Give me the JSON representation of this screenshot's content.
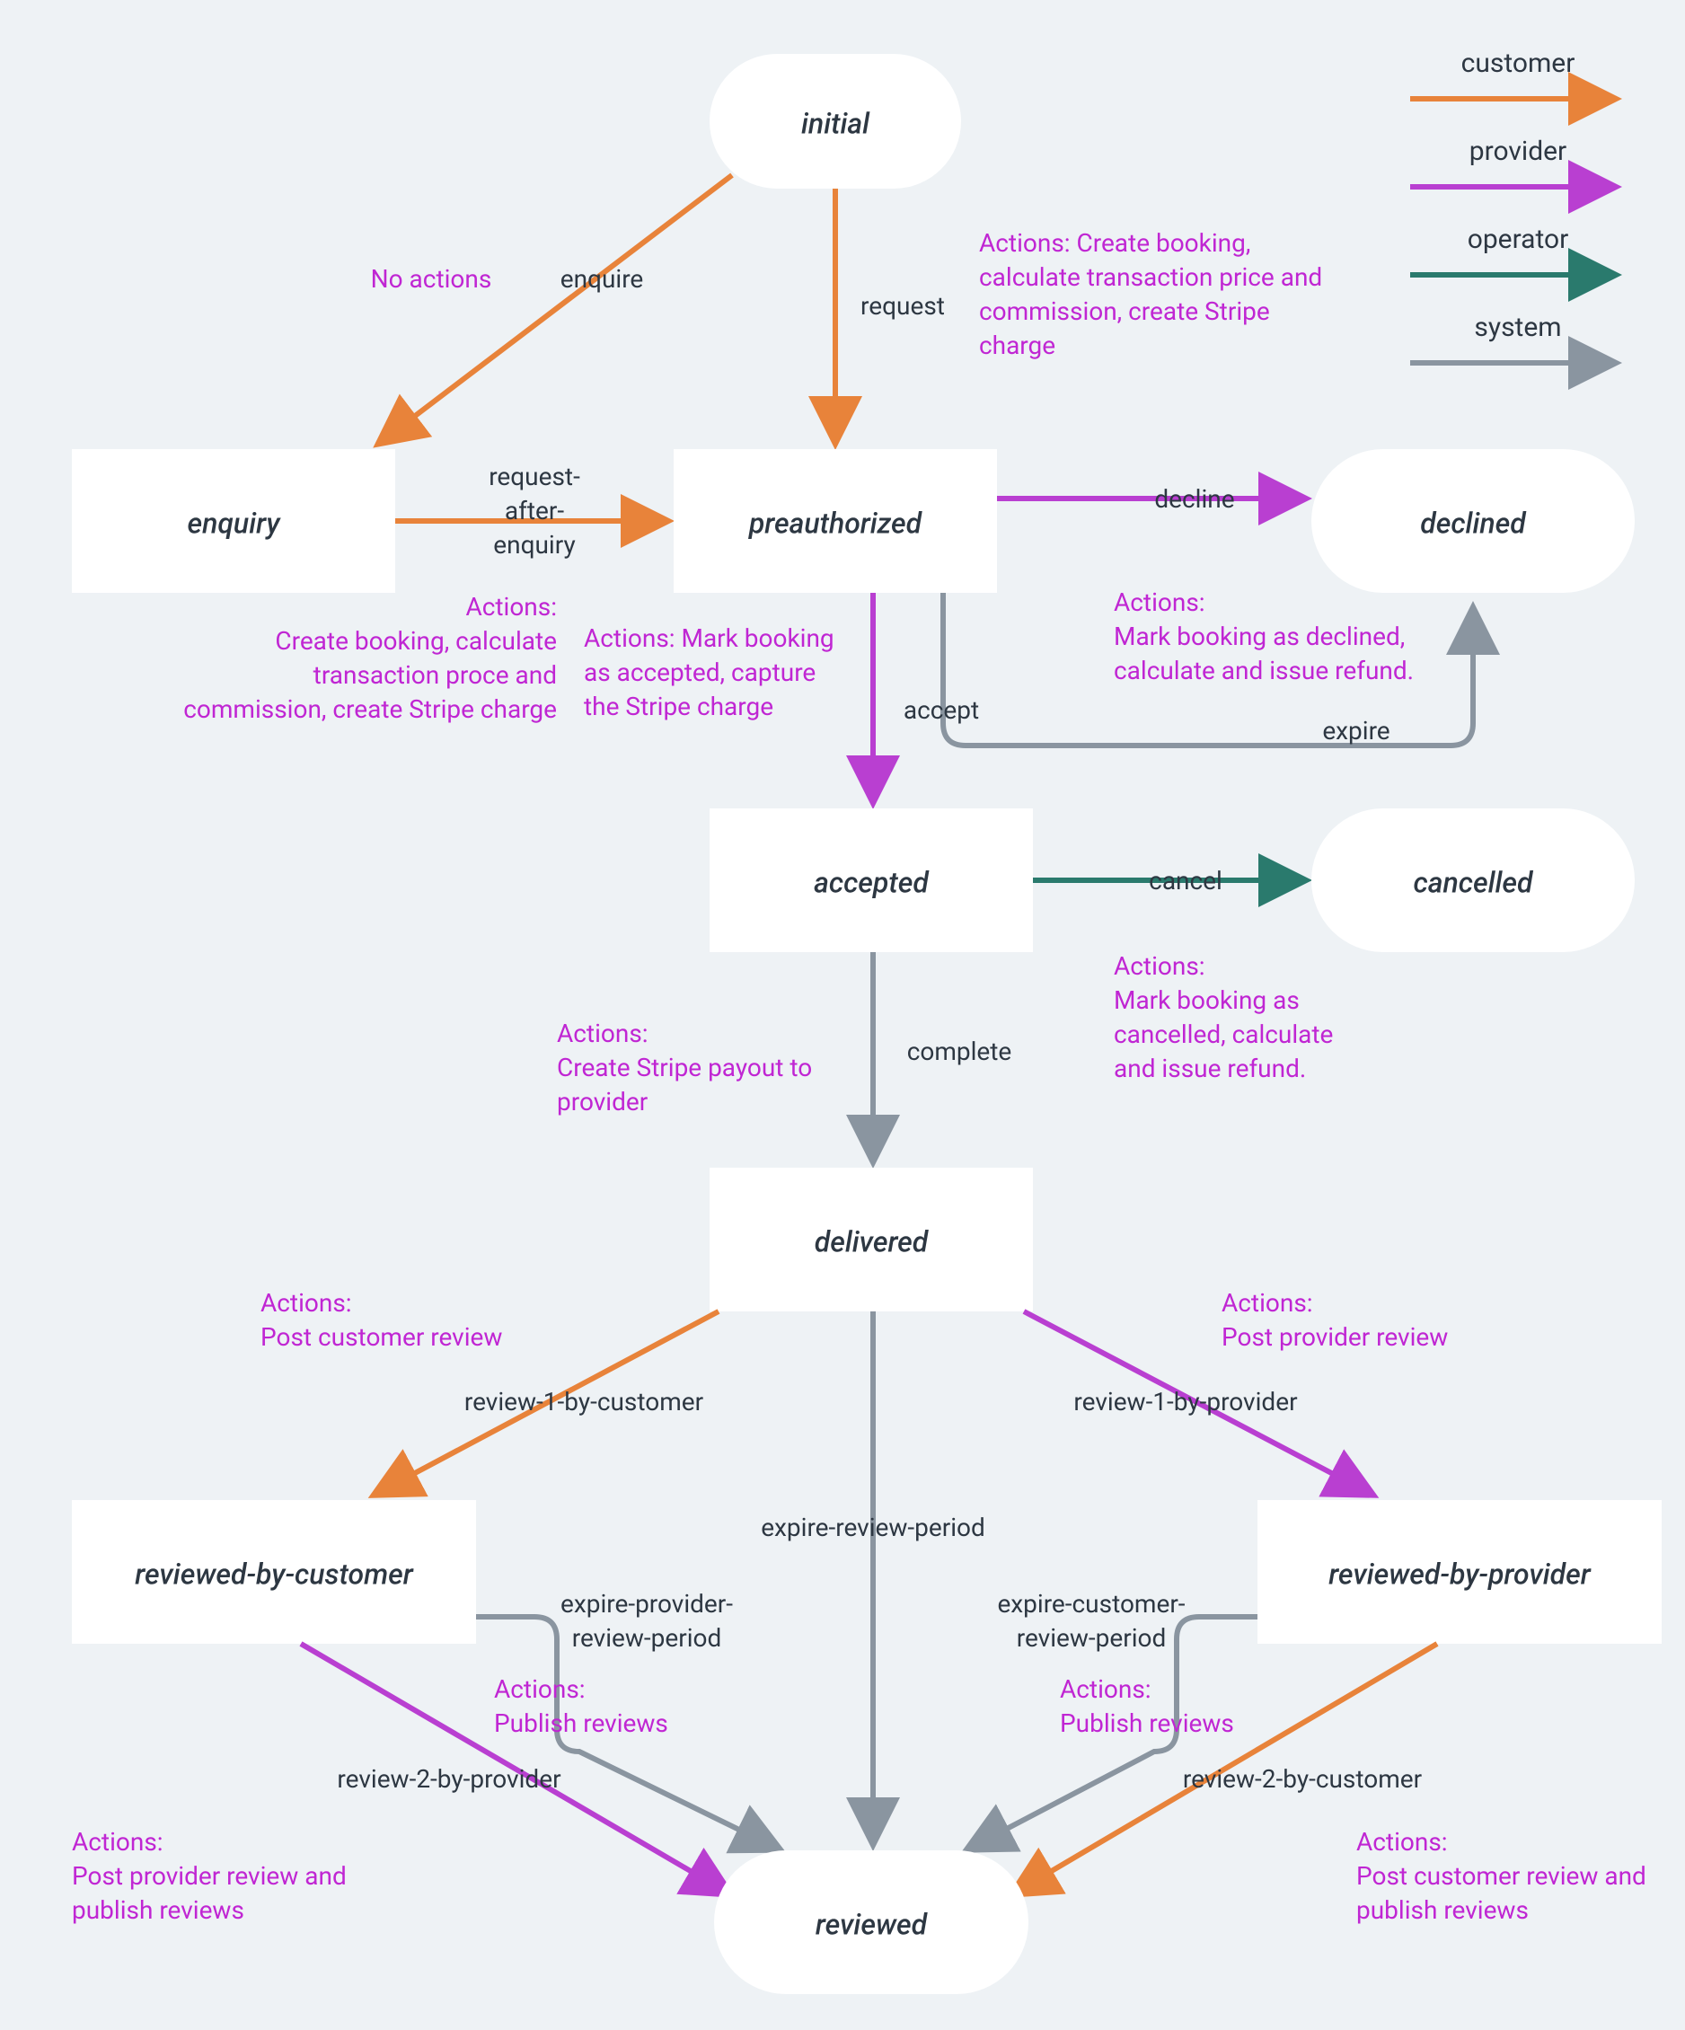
{
  "legend": {
    "customer": "customer",
    "provider": "provider",
    "operator": "operator",
    "system": "system"
  },
  "states": {
    "initial": "initial",
    "enquiry": "enquiry",
    "preauthorized": "preauthorized",
    "declined": "declined",
    "accepted": "accepted",
    "cancelled": "cancelled",
    "delivered": "delivered",
    "reviewedByCustomer": "reviewed-by-customer",
    "reviewedByProvider": "reviewed-by-provider",
    "reviewed": "reviewed"
  },
  "transitions": {
    "enquire": "enquire",
    "request": "request",
    "requestAfterEnquiry1": "request-",
    "requestAfterEnquiry2": "after-",
    "requestAfterEnquiry3": "enquiry",
    "decline": "decline",
    "accept": "accept",
    "expire": "expire",
    "cancel": "cancel",
    "complete": "complete",
    "review1Customer": "review-1-by-customer",
    "review1Provider": "review-1-by-provider",
    "expireReviewPeriod": "expire-review-period",
    "expireProviderRP1": "expire-provider-",
    "expireProviderRP2": "review-period",
    "expireCustomerRP1": "expire-customer-",
    "expireCustomerRP2": "review-period",
    "review2Provider": "review-2-by-provider",
    "review2Customer": "review-2-by-customer"
  },
  "actions": {
    "noActions": "No actions",
    "request1": "Actions: Create booking,",
    "request2": "calculate transaction price and",
    "request3": "commission, create Stripe",
    "request4": "charge",
    "rae1": "Actions:",
    "rae2": "Create booking, calculate",
    "rae3": "transaction proce and",
    "rae4": "commission, create Stripe charge",
    "accept1": "Actions: Mark booking",
    "accept2": "as accepted, capture",
    "accept3": "the Stripe charge",
    "decline1": "Actions:",
    "decline2": "Mark booking as declined,",
    "decline3": "calculate and issue refund.",
    "cancel1": "Actions:",
    "cancel2": "Mark booking as",
    "cancel3": "cancelled, calculate",
    "cancel4": "and issue refund.",
    "complete1": "Actions:",
    "complete2": "Create Stripe payout to",
    "complete3": "provider",
    "r1cust1": "Actions:",
    "r1cust2": "Post customer review",
    "r1prov1": "Actions:",
    "r1prov2": "Post provider review",
    "publish1a": "Actions:",
    "publish1b": "Publish reviews",
    "publish2a": "Actions:",
    "publish2b": "Publish reviews",
    "r2prov1": "Actions:",
    "r2prov2": "Post provider review and",
    "r2prov3": "publish reviews",
    "r2cust1": "Actions:",
    "r2cust2": "Post customer review and",
    "r2cust3": "publish reviews"
  }
}
